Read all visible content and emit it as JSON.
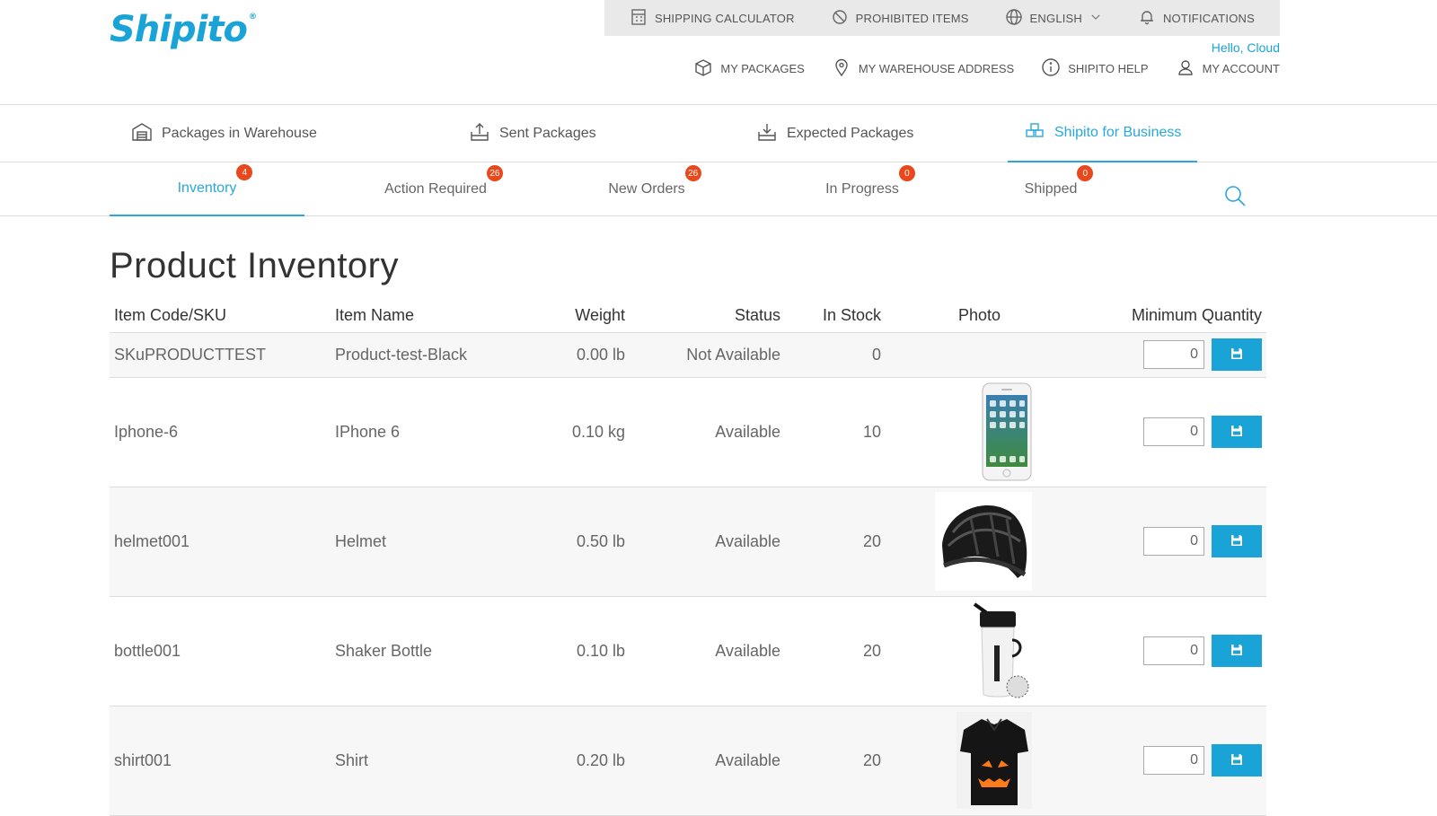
{
  "brand": {
    "logo_text": "Shipito",
    "logo_mark": "®",
    "accent": "#1aa3d6",
    "badge_color": "#e8481c"
  },
  "topbar": {
    "items": [
      {
        "label": "SHIPPING CALCULATOR",
        "icon": "calculator-icon"
      },
      {
        "label": "PROHIBITED ITEMS",
        "icon": "prohibited-icon"
      },
      {
        "label": "ENGLISH",
        "icon": "globe-icon"
      },
      {
        "label": "NOTIFICATIONS",
        "icon": "bell-icon"
      }
    ]
  },
  "account": {
    "greeting": "Hello, Cloud",
    "links": [
      {
        "label": "MY PACKAGES",
        "icon": "package-icon"
      },
      {
        "label": "MY WAREHOUSE ADDRESS",
        "icon": "location-pin-icon"
      },
      {
        "label": "SHIPITO HELP",
        "icon": "info-icon"
      },
      {
        "label": "MY ACCOUNT",
        "icon": "user-icon"
      }
    ]
  },
  "mainnav": {
    "items": [
      {
        "label": "Packages in Warehouse",
        "icon": "warehouse-icon"
      },
      {
        "label": "Sent Packages",
        "icon": "upload-box-icon"
      },
      {
        "label": "Expected Packages",
        "icon": "download-box-icon"
      },
      {
        "label": "Shipito for Business",
        "icon": "business-icon"
      }
    ],
    "active": "Shipito for Business"
  },
  "subtabs": {
    "items": [
      {
        "label": "Inventory",
        "badge": "4"
      },
      {
        "label": "Action Required",
        "badge": "26"
      },
      {
        "label": "New Orders",
        "badge": "26"
      },
      {
        "label": "In Progress",
        "badge": "0"
      },
      {
        "label": "Shipped",
        "badge": "0"
      }
    ],
    "active": "Inventory"
  },
  "page": {
    "title": "Product Inventory"
  },
  "table": {
    "columns": [
      "Item Code/SKU",
      "Item Name",
      "Weight",
      "Status",
      "In Stock",
      "Photo",
      "Minimum Quantity"
    ],
    "rows": [
      {
        "sku": "SKuPRODUCTTEST",
        "name": "Product-test-Black",
        "weight": "0.00 lb",
        "status": "Not Available",
        "stock": "0",
        "photo": "",
        "min_qty": "0"
      },
      {
        "sku": "Iphone-6",
        "name": "IPhone 6",
        "weight": "0.10 kg",
        "status": "Available",
        "stock": "10",
        "photo": "phone-photo",
        "min_qty": "0"
      },
      {
        "sku": "helmet001",
        "name": "Helmet",
        "weight": "0.50 lb",
        "status": "Available",
        "stock": "20",
        "photo": "helmet-photo",
        "min_qty": "0"
      },
      {
        "sku": "bottle001",
        "name": "Shaker Bottle",
        "weight": "0.10 lb",
        "status": "Available",
        "stock": "20",
        "photo": "bottle-photo",
        "min_qty": "0"
      },
      {
        "sku": "shirt001",
        "name": "Shirt",
        "weight": "0.20 lb",
        "status": "Available",
        "stock": "20",
        "photo": "shirt-photo",
        "min_qty": "0"
      }
    ]
  }
}
